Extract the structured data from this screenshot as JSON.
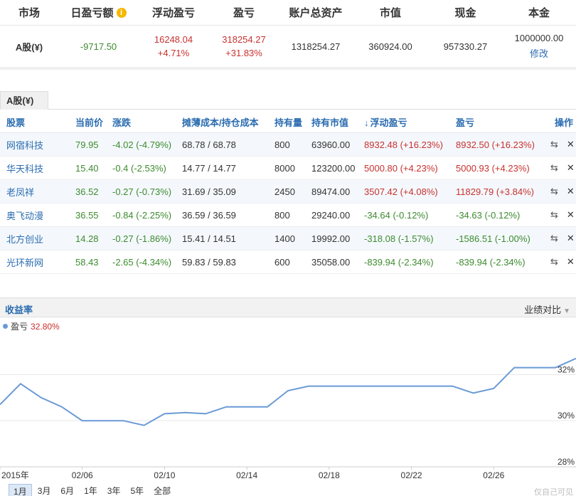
{
  "summary": {
    "headers": [
      "市场",
      "日盈亏额",
      "浮动盈亏",
      "盈亏",
      "账户总资产",
      "市值",
      "现金",
      "本金"
    ],
    "market": "A股(¥)",
    "daily_pl": "-9717.50",
    "float_pl": "16248.04",
    "float_pl_pct": "+4.71%",
    "pl": "318254.27",
    "pl_pct": "+31.83%",
    "total_assets": "1318254.27",
    "market_value": "360924.00",
    "cash": "957330.27",
    "principal": "1000000.00",
    "modify_link": "修改"
  },
  "tab_label": "A股(¥)",
  "holdings": {
    "headers": [
      "股票",
      "当前价",
      "涨跌",
      "摊薄成本/持仓成本",
      "持有量",
      "持有市值",
      "浮动盈亏",
      "盈亏",
      "操作"
    ],
    "rows": [
      {
        "name": "网宿科技",
        "price": "79.95",
        "change": "-4.02 (-4.79%)",
        "cost": "68.78 / 68.78",
        "qty": "800",
        "value": "63960.00",
        "float_pl": "8932.48 (+16.23%)",
        "pl": "8932.50 (+16.23%)",
        "float_pos": true,
        "pl_pos": true
      },
      {
        "name": "华天科技",
        "price": "15.40",
        "change": "-0.4 (-2.53%)",
        "cost": "14.77 / 14.77",
        "qty": "8000",
        "value": "123200.00",
        "float_pl": "5000.80 (+4.23%)",
        "pl": "5000.93 (+4.23%)",
        "float_pos": true,
        "pl_pos": true
      },
      {
        "name": "老凤祥",
        "price": "36.52",
        "change": "-0.27 (-0.73%)",
        "cost": "31.69 / 35.09",
        "qty": "2450",
        "value": "89474.00",
        "float_pl": "3507.42 (+4.08%)",
        "pl": "11829.79 (+3.84%)",
        "float_pos": true,
        "pl_pos": true
      },
      {
        "name": "奥飞动漫",
        "price": "36.55",
        "change": "-0.84 (-2.25%)",
        "cost": "36.59 / 36.59",
        "qty": "800",
        "value": "29240.00",
        "float_pl": "-34.64 (-0.12%)",
        "pl": "-34.63 (-0.12%)",
        "float_pos": false,
        "pl_pos": false
      },
      {
        "name": "北方创业",
        "price": "14.28",
        "change": "-0.27 (-1.86%)",
        "cost": "15.41 / 14.51",
        "qty": "1400",
        "value": "19992.00",
        "float_pl": "-318.08 (-1.57%)",
        "pl": "-1586.51 (-1.00%)",
        "float_pos": false,
        "pl_pos": false
      },
      {
        "name": "光环新网",
        "price": "58.43",
        "change": "-2.65 (-4.34%)",
        "cost": "59.83 / 59.83",
        "qty": "600",
        "value": "35058.00",
        "float_pl": "-839.94 (-2.34%)",
        "pl": "-839.94 (-2.34%)",
        "float_pos": false,
        "pl_pos": false
      }
    ]
  },
  "chart_section": {
    "title": "收益率",
    "compare_label": "业绩对比",
    "legend_name": "盈亏",
    "legend_value": "32.80%",
    "ranges": [
      "1月",
      "3月",
      "6月",
      "1年",
      "3年",
      "5年",
      "全部"
    ],
    "active_range": "1月",
    "watermark": "仅自己可见"
  },
  "chart_data": {
    "type": "line",
    "series": [
      {
        "name": "盈亏",
        "values": [
          30.7,
          31.6,
          31.0,
          30.6,
          30.0,
          30.0,
          30.0,
          29.8,
          30.3,
          30.35,
          30.3,
          30.6,
          30.6,
          30.6,
          31.3,
          31.5,
          31.5,
          31.5,
          31.5,
          31.5,
          31.5,
          31.5,
          31.5,
          31.2,
          31.4,
          32.3,
          32.3,
          32.3,
          32.7
        ]
      }
    ],
    "x_tick_labels": [
      "2015年",
      "02/06",
      "02/10",
      "02/14",
      "02/18",
      "02/22",
      "02/26"
    ],
    "y_tick_labels": [
      "32%",
      "30%",
      "28%"
    ],
    "ylim": [
      28,
      33.8
    ],
    "grid": true,
    "color": "#6a9ad6"
  }
}
